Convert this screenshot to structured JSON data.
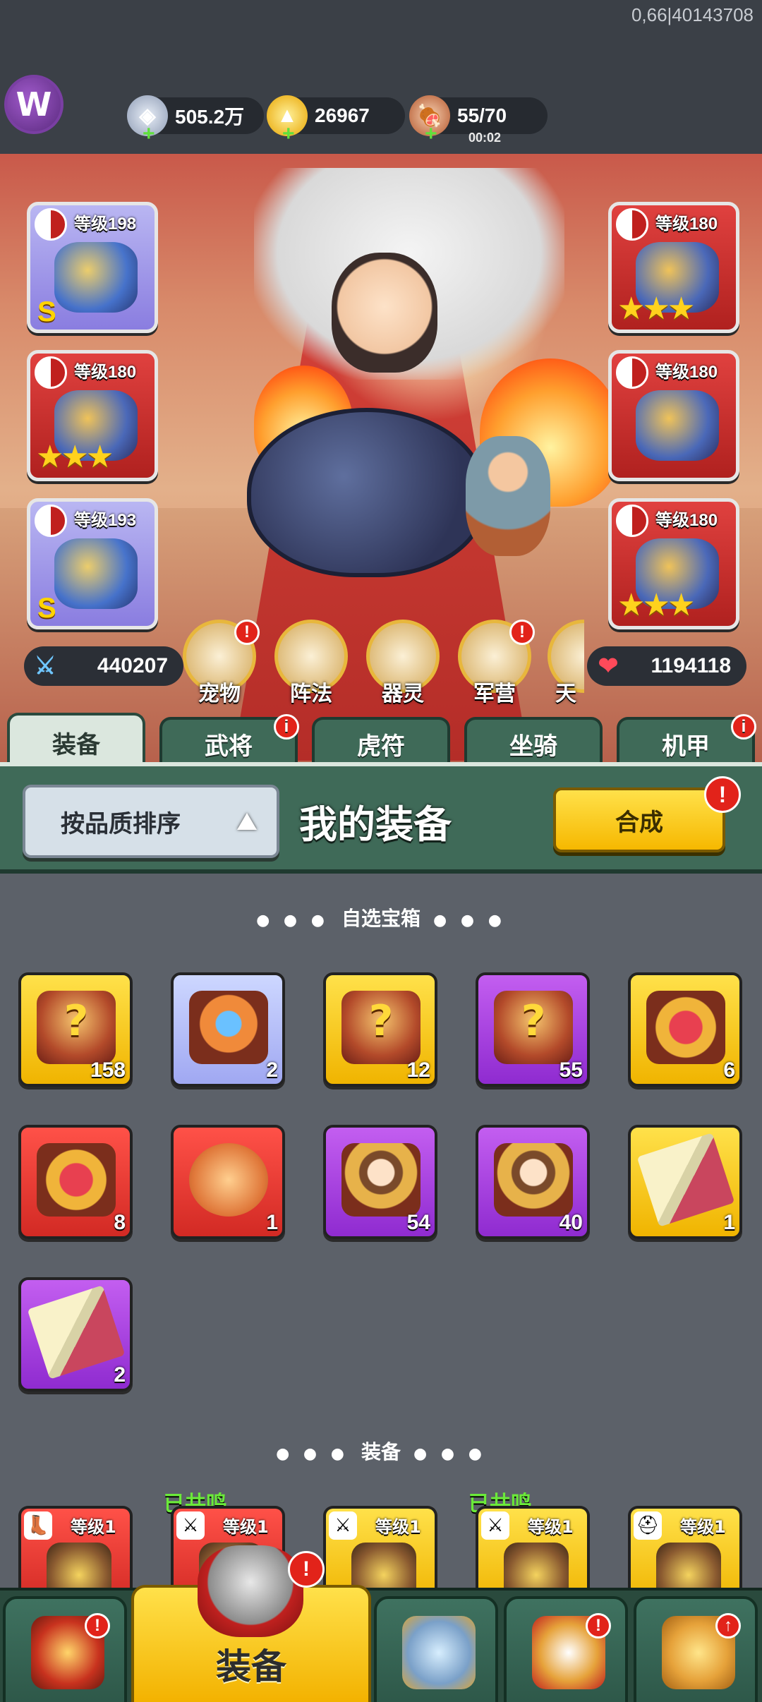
{
  "debug": "0,66|40143708",
  "resources": {
    "silver": "505.2万",
    "gold": "26967",
    "stamina": "55/70",
    "stamina_timer": "00:02"
  },
  "slots": {
    "left": [
      {
        "level": "等级198",
        "grade": "S"
      },
      {
        "level": "等级180",
        "stars": "★★★"
      },
      {
        "level": "等级193",
        "grade": "S"
      }
    ],
    "right": [
      {
        "level": "等级180",
        "stars": "★★★"
      },
      {
        "level": "等级180"
      },
      {
        "level": "等级180",
        "stars": "★★★"
      }
    ]
  },
  "stats": {
    "attack": "440207",
    "hp": "1194118"
  },
  "features": [
    {
      "label": "宠物",
      "badge": "!"
    },
    {
      "label": "阵法"
    },
    {
      "label": "器灵"
    },
    {
      "label": "军营",
      "badge": "!"
    },
    {
      "label": "天"
    }
  ],
  "tabs": [
    {
      "label": "装备"
    },
    {
      "label": "武将",
      "badge": "i"
    },
    {
      "label": "虎符"
    },
    {
      "label": "坐骑"
    },
    {
      "label": "机甲",
      "badge": "i"
    }
  ],
  "panel": {
    "sort_label": "按品质排序",
    "title": "我的装备",
    "merge_label": "合成",
    "merge_badge": "!"
  },
  "sections": {
    "chests": "自选宝箱",
    "equipment": "装备",
    "dots_left": "● ● ●",
    "dots_right": "● ● ●"
  },
  "items": [
    {
      "count": "158",
      "icon": "mystery-chest-icon"
    },
    {
      "count": "2",
      "icon": "hero-chest-icon"
    },
    {
      "count": "12",
      "icon": "mystery-chest-icon"
    },
    {
      "count": "55",
      "icon": "mystery-chest-icon"
    },
    {
      "count": "6",
      "icon": "puzzle-chest-icon"
    },
    {
      "count": "8",
      "icon": "puzzle-chest-icon"
    },
    {
      "count": "1",
      "icon": "pouch-icon"
    },
    {
      "count": "54",
      "icon": "hero-chest-icon"
    },
    {
      "count": "40",
      "icon": "hero-chest-icon"
    },
    {
      "count": "1",
      "icon": "scroll-book-icon"
    },
    {
      "count": "2",
      "icon": "scroll-book-icon"
    }
  ],
  "equipment": [
    {
      "level": "等级1",
      "icon": "boot-icon"
    },
    {
      "level": "等级1",
      "icon": "sword-icon",
      "resonance": "已共鸣"
    },
    {
      "level": "等级1",
      "icon": "sword-icon"
    },
    {
      "level": "等级1",
      "icon": "sword-icon",
      "resonance": "已共鸣"
    },
    {
      "level": "等级1",
      "icon": "helmet-icon"
    }
  ],
  "nav": {
    "active_label": "装备"
  },
  "colors": {
    "gold": "#ffe14a",
    "purple": "#c35ef0",
    "red": "#ff5148",
    "tab_green": "#3f6a58",
    "badge_red": "#e2231a"
  }
}
